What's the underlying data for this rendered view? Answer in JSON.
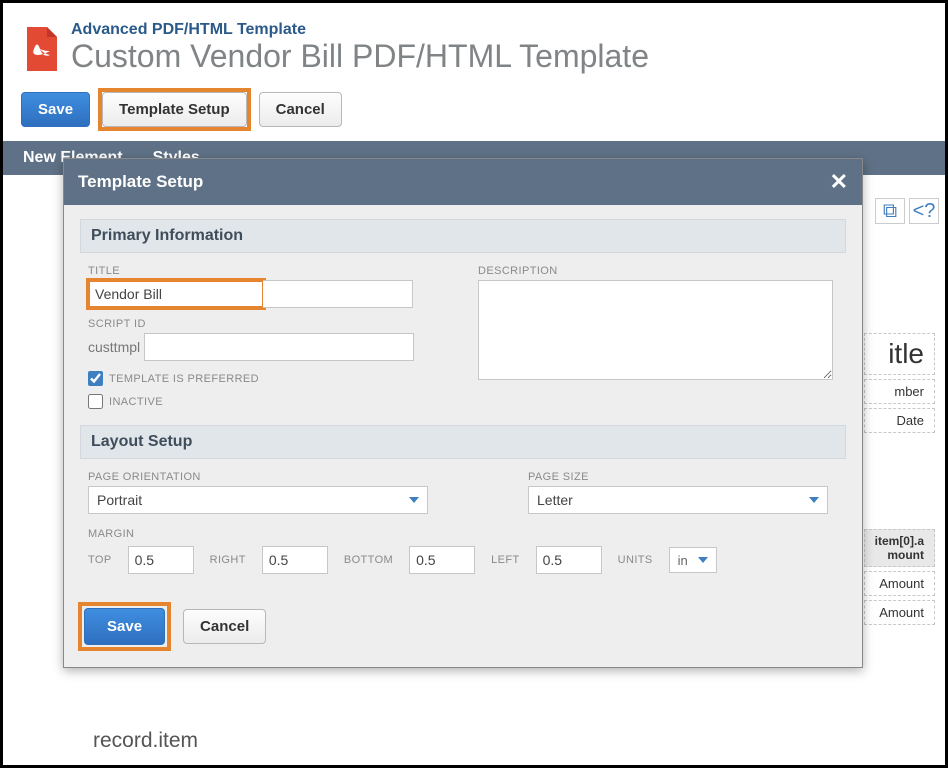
{
  "header": {
    "breadcrumb": "Advanced PDF/HTML Template",
    "title": "Custom Vendor Bill PDF/HTML Template"
  },
  "toolbar": {
    "save": "Save",
    "template_setup": "Template Setup",
    "cancel": "Cancel"
  },
  "menubar": {
    "new_element": "New Element",
    "styles": "Styles"
  },
  "canvas": {
    "title_cell": "itle",
    "number_cell": "mber",
    "date_cell": "Date",
    "col_hdr": "item[0].a\nmount",
    "row1": "Amount",
    "row2": "Amount",
    "bottom": "record.item",
    "code_icon1": "⧉",
    "code_icon2": "<?"
  },
  "modal": {
    "title": "Template Setup",
    "close": "✕",
    "primary_info": "Primary Information",
    "layout_setup": "Layout Setup",
    "labels": {
      "title": "TITLE",
      "description": "DESCRIPTION",
      "script_id": "SCRIPT ID",
      "template_preferred": "TEMPLATE IS PREFERRED",
      "inactive": "INACTIVE",
      "page_orientation": "PAGE ORIENTATION",
      "page_size": "PAGE SIZE",
      "margin": "MARGIN",
      "top": "TOP",
      "right": "RIGHT",
      "bottom": "BOTTOM",
      "left": "LEFT",
      "units": "UNITS"
    },
    "values": {
      "title": "Vendor Bill",
      "script_id_prefix": "custtmpl",
      "script_id": "",
      "description": "",
      "template_preferred": true,
      "inactive": false,
      "orientation": "Portrait",
      "page_size": "Letter",
      "margin_top": "0.5",
      "margin_right": "0.5",
      "margin_bottom": "0.5",
      "margin_left": "0.5",
      "margin_units": "in"
    },
    "actions": {
      "save": "Save",
      "cancel": "Cancel"
    }
  }
}
